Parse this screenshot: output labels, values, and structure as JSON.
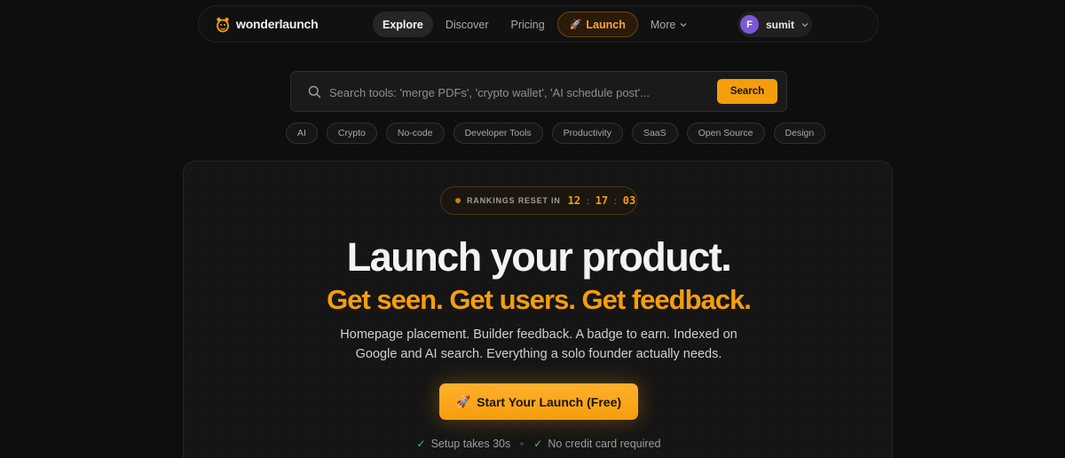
{
  "nav": {
    "logo_text": "wonderlaunch",
    "logo_icon": "rocket-bear-icon",
    "links": [
      {
        "label": "Explore",
        "active": true
      },
      {
        "label": "Discover"
      },
      {
        "label": "Pricing"
      }
    ],
    "launch": {
      "label": "Launch",
      "icon": "rocket-icon"
    },
    "more": {
      "label": "More",
      "icon": "chevron-down-icon"
    },
    "user": {
      "initial": "F",
      "name": "sumit",
      "avatar_color": "#7c57d6"
    }
  },
  "search": {
    "placeholder": "Search tools: 'merge PDFs', 'crypto wallet', 'AI schedule post'...",
    "value": "",
    "button_label": "Search"
  },
  "chips": [
    "AI",
    "Crypto",
    "No-code",
    "Developer Tools",
    "Productivity",
    "SaaS",
    "Open Source",
    "Design"
  ],
  "hero": {
    "countdown_label": "RANKINGS RESET IN",
    "countdown": {
      "hours": "12",
      "minutes": "17",
      "seconds": "03"
    },
    "headline": "Launch your product.",
    "subheadline": "Get seen. Get users. Get feedback.",
    "description": "Homepage placement. Builder feedback. A badge to earn. Indexed on Google and AI search. Everything a solo founder actually needs.",
    "cta_label": "Start Your Launch (Free)",
    "perks": [
      "Setup takes 30s",
      "No credit card required"
    ]
  },
  "colors": {
    "accent": "#f59e0b",
    "background": "#0e0e0e",
    "check": "#39c96a"
  }
}
